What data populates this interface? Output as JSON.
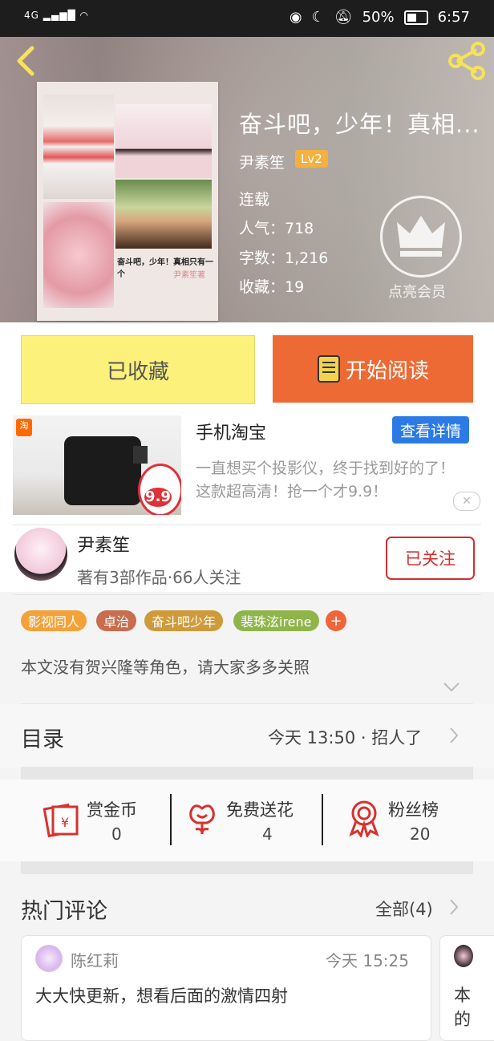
{
  "status_bar": {
    "network": "4G",
    "battery": "50%",
    "time": "6:57"
  },
  "book": {
    "title": "奋斗吧，少年！真相...",
    "author": "尹素笙",
    "level": "Lv2",
    "status": "连载",
    "popularity": "人气：718",
    "word_count": "字数：1,216",
    "favorites": "收藏：19",
    "vip_label": "点亮会员",
    "cover_text": "奋斗吧，少年！真相只有一个",
    "cover_sig": "尹素笙著"
  },
  "actions": {
    "favorited": "已收藏",
    "start_reading": "开始阅读"
  },
  "ad": {
    "logo": "淘",
    "title": "手机淘宝",
    "button": "查看详情",
    "desc": "一直想买个投影仪，终于找到好的了！这款超高清！抢一个才9.9！",
    "price": "9.9",
    "close": "✕"
  },
  "author_card": {
    "name": "尹素笙",
    "stats": "著有3部作品·66人关注",
    "follow": "已关注"
  },
  "tags": [
    {
      "label": "影视同人",
      "color": "#f3a23a"
    },
    {
      "label": "卓治",
      "color": "#c86d4d"
    },
    {
      "label": "奋斗吧少年",
      "color": "#cf9a3a"
    },
    {
      "label": "裴珠泫irene",
      "color": "#8fb54a"
    }
  ],
  "tag_more": "+",
  "summary": "本文没有贺兴隆等角色，请大家多多关照",
  "catalog": {
    "label": "目录",
    "latest": "今天 13:50 · 招人了"
  },
  "stats": [
    {
      "label": "赏金币",
      "value": "0",
      "icon": "reward-icon"
    },
    {
      "label": "免费送花",
      "value": "4",
      "icon": "flower-icon"
    },
    {
      "label": "粉丝榜",
      "value": "20",
      "icon": "medal-icon"
    }
  ],
  "comments": {
    "label": "热门评论",
    "all": "全部(4)",
    "items": [
      {
        "user": "陈红莉",
        "time": "今天 15:25",
        "text": "大大快更新，想看后面的激情四射"
      },
      {
        "text": "本的"
      }
    ]
  }
}
